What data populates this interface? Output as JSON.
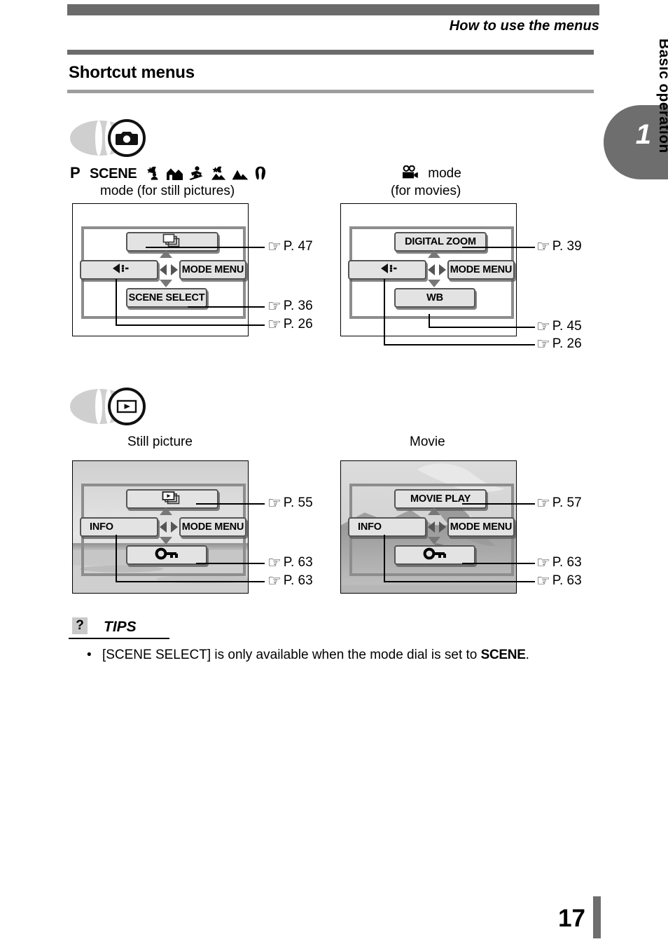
{
  "header": {
    "running_title": "How to use the menus",
    "section_title": "Shortcut menus"
  },
  "side_tab": {
    "number": "1",
    "label": "Basic operation"
  },
  "shooting_section": {
    "badge_icon": "camera-icon",
    "still_modes": {
      "p_label": "P",
      "scene_label": "SCENE",
      "scene_icons": [
        "night-portrait-icon",
        "indoor-icon",
        "sports-icon",
        "night-scene-icon",
        "landscape-icon",
        "self-portrait-icon"
      ],
      "caption": "mode (for still pictures)"
    },
    "movie_mode": {
      "icon": "movie-camera-icon",
      "caption_line1": "mode",
      "caption_line2": "(for movies)"
    },
    "still_menu": {
      "top_button": "drive-mode-icon",
      "left_button": "flash-mode-icon",
      "right_button": "MODE MENU",
      "bottom_button": "SCENE SELECT",
      "refs": {
        "top": "P. 47",
        "bottom": "P. 36",
        "left": "P. 26"
      }
    },
    "movie_menu": {
      "top_button": "DIGITAL ZOOM",
      "left_button": "flash-mode-icon",
      "right_button": "MODE MENU",
      "bottom_button": "WB",
      "refs": {
        "top": "P. 39",
        "bottom": "P. 45",
        "left": "P. 26"
      }
    }
  },
  "playback_section": {
    "badge_icon": "playback-icon",
    "still_caption": "Still picture",
    "movie_caption": "Movie",
    "still_menu": {
      "top_button": "slideshow-icon",
      "left_button": "INFO",
      "right_button": "MODE MENU",
      "bottom_button": "protect-key-icon",
      "refs": {
        "top": "P. 55",
        "bottom": "P. 63",
        "left": "P. 63"
      }
    },
    "movie_menu": {
      "top_button": "MOVIE PLAY",
      "left_button": "INFO",
      "right_button": "MODE MENU",
      "bottom_button": "protect-key-icon",
      "refs": {
        "top": "P. 57",
        "bottom": "P. 63",
        "left": "P. 63"
      }
    }
  },
  "tips": {
    "badge": "?",
    "title": "TIPS",
    "bullet": "•",
    "item_prefix": "[SCENE SELECT] is only available when the mode dial is set to ",
    "item_keyword": "SCENE",
    "item_suffix": "."
  },
  "footer": {
    "page_number": "17"
  },
  "reference_hand_glyph": "☞"
}
